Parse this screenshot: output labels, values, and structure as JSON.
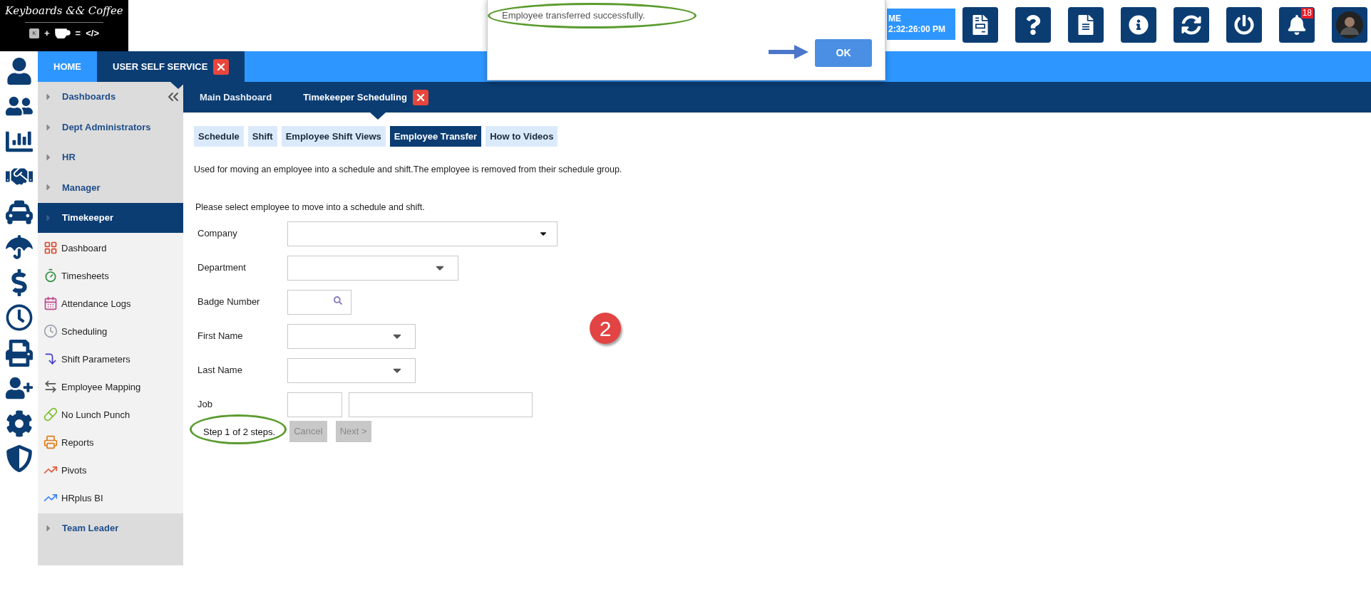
{
  "logo": {
    "title": "Keyboards && Coffee",
    "key": "K",
    "plus": "+",
    "equals": "=",
    "code": "</>"
  },
  "clock": {
    "line_1": "ME",
    "line_2": "2:32:26:00 PM"
  },
  "notifications": {
    "count": "18"
  },
  "dialog": {
    "message": "Employee transferred successfully.",
    "button": "OK"
  },
  "top_tabs": [
    {
      "label": "HOME",
      "selected": false,
      "closable": false
    },
    {
      "label": "USER SELF SERVICE",
      "selected": true,
      "closable": true
    }
  ],
  "sidebar": {
    "sections": [
      {
        "label": "Dashboards",
        "selected": false
      },
      {
        "label": "Dept Administrators",
        "selected": false
      },
      {
        "label": "HR",
        "selected": false
      },
      {
        "label": "Manager",
        "selected": false
      },
      {
        "label": "Timekeeper",
        "selected": true,
        "children": [
          {
            "label": "Dashboard"
          },
          {
            "label": "Timesheets"
          },
          {
            "label": "Attendance Logs"
          },
          {
            "label": "Scheduling"
          },
          {
            "label": "Shift Parameters"
          },
          {
            "label": "Employee Mapping"
          },
          {
            "label": "No Lunch Punch"
          },
          {
            "label": "Reports"
          },
          {
            "label": "Pivots"
          },
          {
            "label": "HRplus BI"
          }
        ]
      },
      {
        "label": "Team Leader",
        "selected": false
      }
    ]
  },
  "sub_tabs": [
    {
      "label": "Main Dashboard",
      "selected": false,
      "closable": false
    },
    {
      "label": "Timekeeper Scheduling",
      "selected": true,
      "closable": true
    }
  ],
  "page_tabs": [
    {
      "label": "Schedule",
      "selected": false
    },
    {
      "label": "Shift",
      "selected": false
    },
    {
      "label": "Employee Shift Views",
      "selected": false
    },
    {
      "label": "Employee Transfer",
      "selected": true
    },
    {
      "label": "How to Videos",
      "selected": false
    }
  ],
  "description": "Used for moving an employee into a schedule and shift.The employee is removed from their schedule group.",
  "instruction": "Please select employee to move into a schedule and shift.",
  "form": {
    "fields": [
      {
        "label": "Company",
        "kind": "native-select"
      },
      {
        "label": "Department",
        "kind": "select"
      },
      {
        "label": "Badge Number",
        "kind": "search"
      },
      {
        "label": "First Name",
        "kind": "select"
      },
      {
        "label": "Last Name",
        "kind": "select"
      },
      {
        "label": "Job",
        "kind": "pair"
      }
    ]
  },
  "step": "Step 1 of 2 steps.",
  "buttons": [
    {
      "label": "Cancel",
      "disabled": true
    },
    {
      "label": "Next >",
      "disabled": true
    }
  ],
  "callout": {
    "number": "2"
  }
}
